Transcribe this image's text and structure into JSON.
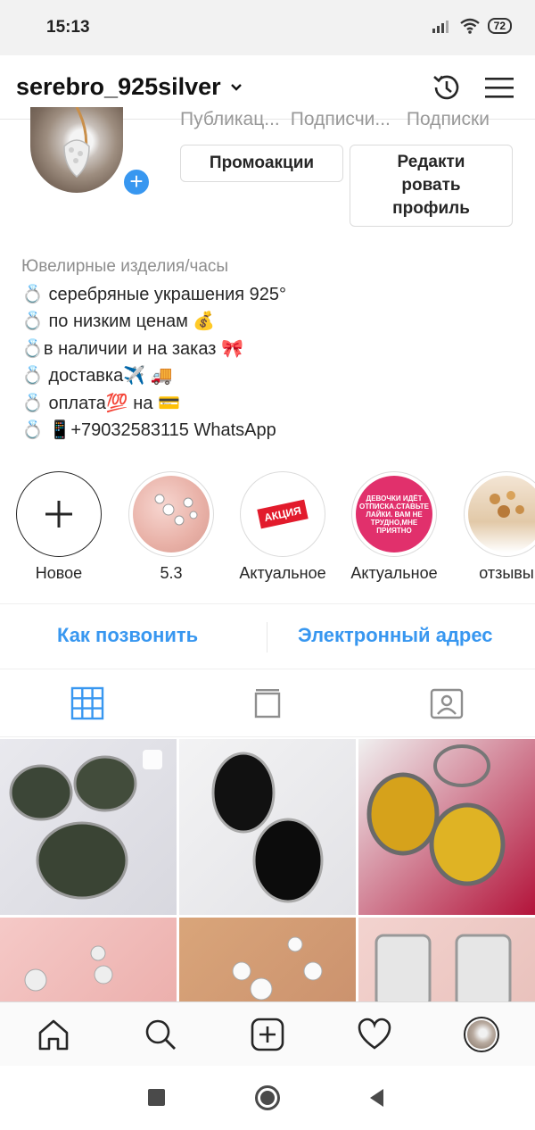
{
  "status_bar": {
    "time": "15:13",
    "battery": "72",
    "icons": [
      "signal-icon",
      "wifi-icon",
      "battery-icon"
    ]
  },
  "header": {
    "username": "serebro_925silver",
    "icons": [
      "chevron-down-icon",
      "history-icon",
      "menu-icon"
    ]
  },
  "profile": {
    "stats_labels": [
      "Публикац...",
      "Подписчи...",
      "Подписки"
    ],
    "promo_button": "Промоакции",
    "edit_button_lines": [
      "Редакти",
      "ровать",
      "профиль"
    ]
  },
  "bio": {
    "category": "Ювелирные изделия/часы",
    "lines": [
      "💍 серебряные украшения 925°",
      "💍 по низким ценам 💰",
      "💍в наличии и на заказ 🎀",
      "💍 доставка✈️ 🚚",
      "💍 оплата💯 на 💳",
      "💍 📱+79032583115 WhatsApp"
    ]
  },
  "highlights": [
    {
      "label": "Новое",
      "icon": "plus-icon"
    },
    {
      "label": "5.3"
    },
    {
      "label": "Актуальное",
      "text": "АКЦИЯ"
    },
    {
      "label": "Актуальное",
      "text": "ДЕВОЧКИ ИДЁТ ОТПИСКА.СТАВЬТЕ ЛАЙКИ. ВАМ НЕ ТРУДНО,МНЕ ПРИЯТНО"
    },
    {
      "label": "отзывы"
    }
  ],
  "contacts": {
    "call": "Как позвонить",
    "email": "Электронный адрес"
  },
  "tabs": [
    "grid-icon",
    "feed-icon",
    "tagged-icon"
  ],
  "bottom_nav": [
    "home-icon",
    "search-icon",
    "new-post-icon",
    "activity-icon",
    "profile-avatar"
  ],
  "system_nav": [
    "recents-button",
    "home-button",
    "back-button"
  ],
  "colors": {
    "accent": "#3897f0",
    "text": "#262626",
    "muted": "#8e8e8e",
    "border": "#dbdbdb",
    "highlight_bg": "#e1306c"
  }
}
